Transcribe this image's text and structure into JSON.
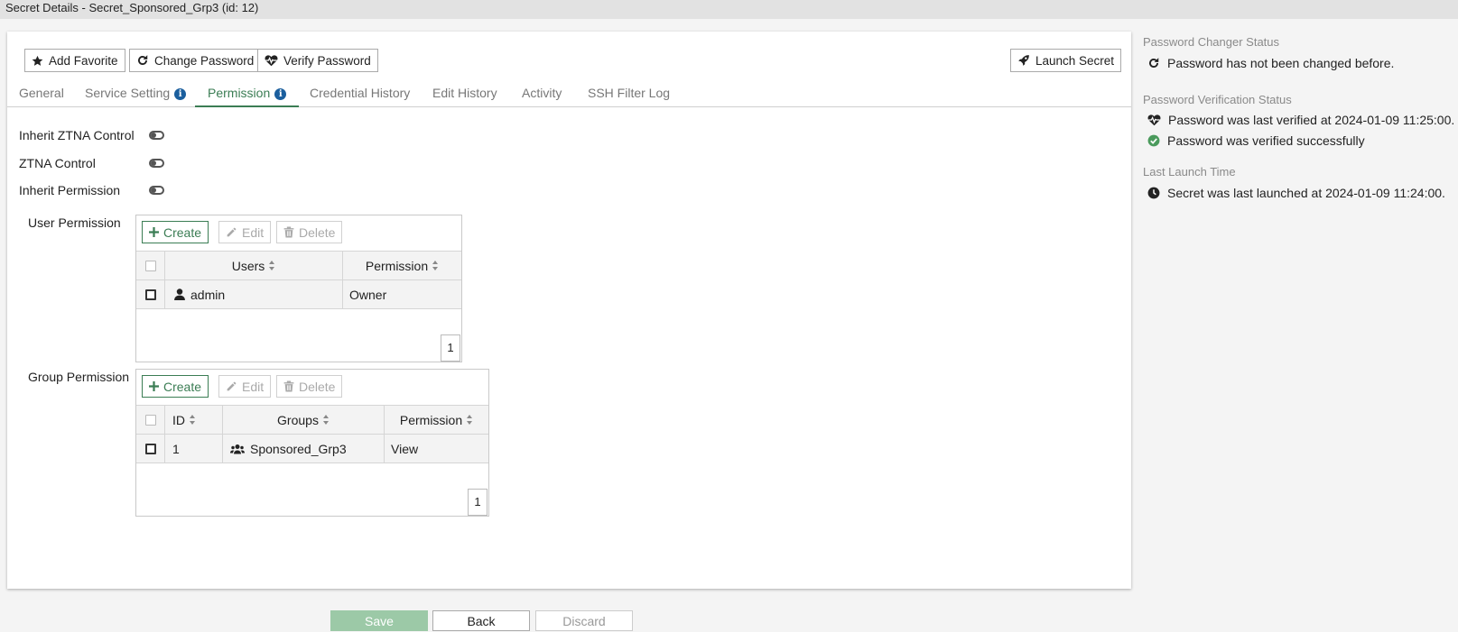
{
  "window": {
    "title": "Secret Details - Secret_Sponsored_Grp3 (id: 12)"
  },
  "toolbar": {
    "add_favorite": "Add Favorite",
    "change_password": "Change Password",
    "verify_password": "Verify Password",
    "launch_secret": "Launch Secret"
  },
  "tabs": [
    {
      "label": "General"
    },
    {
      "label": "Service Setting"
    },
    {
      "label": "Permission"
    },
    {
      "label": "Credential History"
    },
    {
      "label": "Edit History"
    },
    {
      "label": "Activity"
    },
    {
      "label": "SSH Filter Log"
    }
  ],
  "active_tab": "Permission",
  "toggles": [
    {
      "label": "Inherit ZTNA Control",
      "on": false
    },
    {
      "label": "ZTNA Control",
      "on": false
    },
    {
      "label": "Inherit Permission",
      "on": false
    }
  ],
  "user_permission": {
    "label": "User Permission",
    "buttons": {
      "create": "Create",
      "edit": "Edit",
      "delete": "Delete"
    },
    "columns": [
      "Users",
      "Permission"
    ],
    "rows": [
      {
        "user": "admin",
        "permission": "Owner"
      }
    ],
    "page": "1"
  },
  "group_permission": {
    "label": "Group Permission",
    "buttons": {
      "create": "Create",
      "edit": "Edit",
      "delete": "Delete"
    },
    "columns": [
      "ID",
      "Groups",
      "Permission"
    ],
    "rows": [
      {
        "id": "1",
        "group": "Sponsored_Grp3",
        "permission": "View"
      }
    ],
    "page": "1"
  },
  "footer": {
    "save": "Save",
    "back": "Back",
    "discard": "Discard"
  },
  "status": {
    "changer_title": "Password Changer Status",
    "changer_text": "Password has not been changed before.",
    "verification_title": "Password Verification Status",
    "verification_text": "Password was last verified at 2024-01-09 11:25:00.",
    "verification_result": "Password was verified successfully",
    "launch_title": "Last Launch Time",
    "launch_text": "Secret was last launched at 2024-01-09 11:24:00."
  },
  "colors": {
    "accent": "#3b7d54",
    "info": "#1b5f9e",
    "success": "#4a9a5c",
    "save_disabled": "#9cc9a7"
  }
}
